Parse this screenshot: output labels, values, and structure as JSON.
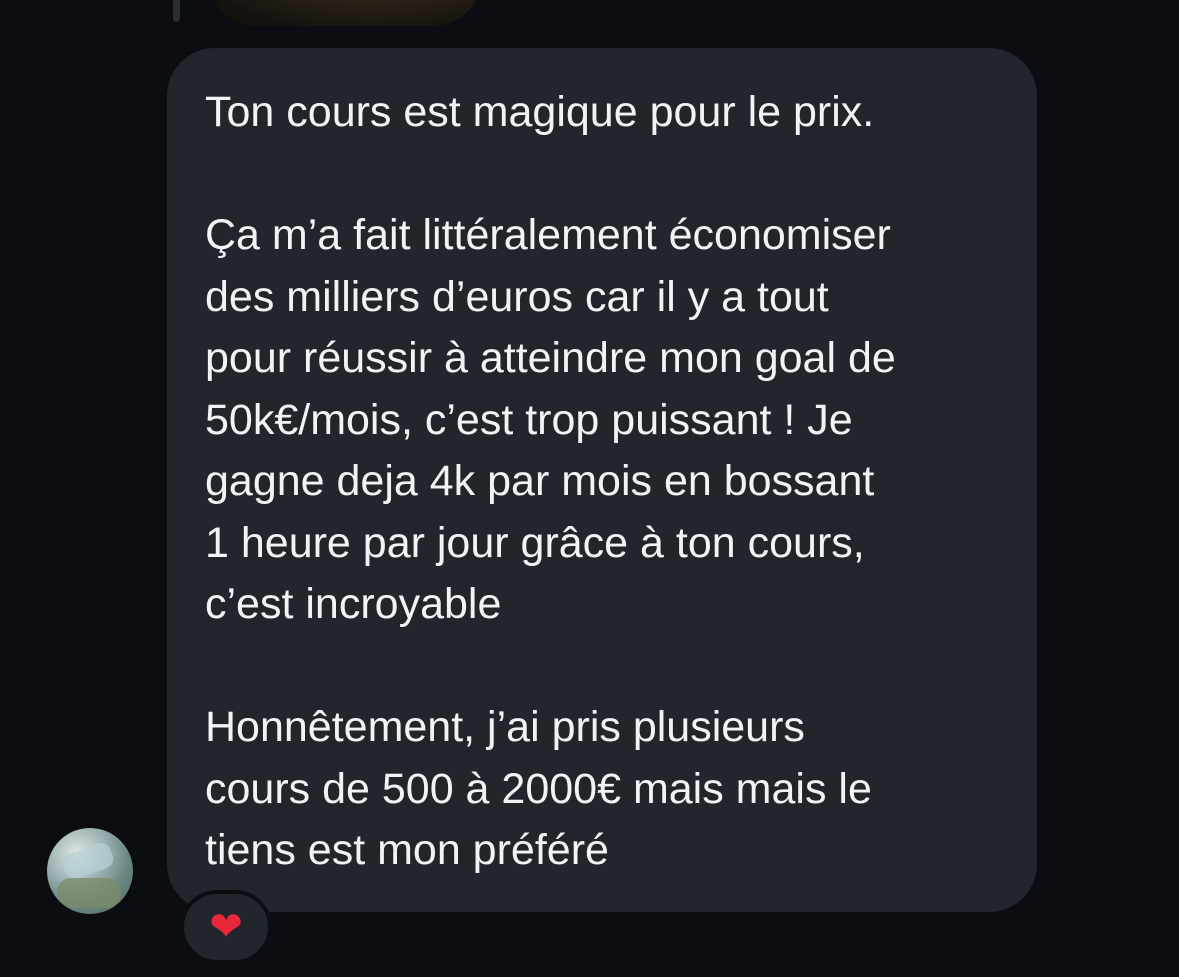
{
  "message": {
    "lines": [
      "Ton cours est magique pour le prix.",
      "",
      "Ça m’a fait littéralement économiser",
      "des milliers d’euros car il y a tout",
      "pour réussir à atteindre mon goal de",
      "50k€/mois, c’est trop puissant ! Je",
      "gagne deja 4k par mois en bossant",
      "1 heure par jour grâce à ton cours,",
      "c’est incroyable",
      "",
      "Honnêtement, j’ai pris plusieurs",
      "cours de 500 à 2000€ mais mais le",
      "tiens est mon préféré"
    ],
    "reaction": "❤"
  },
  "colors": {
    "background": "#0b0d12",
    "bubble": "#22252c",
    "text": "#f2f3f5",
    "heart": "#e8273b"
  },
  "icons": {
    "reaction": "heart-icon",
    "avatar": "avatar"
  }
}
